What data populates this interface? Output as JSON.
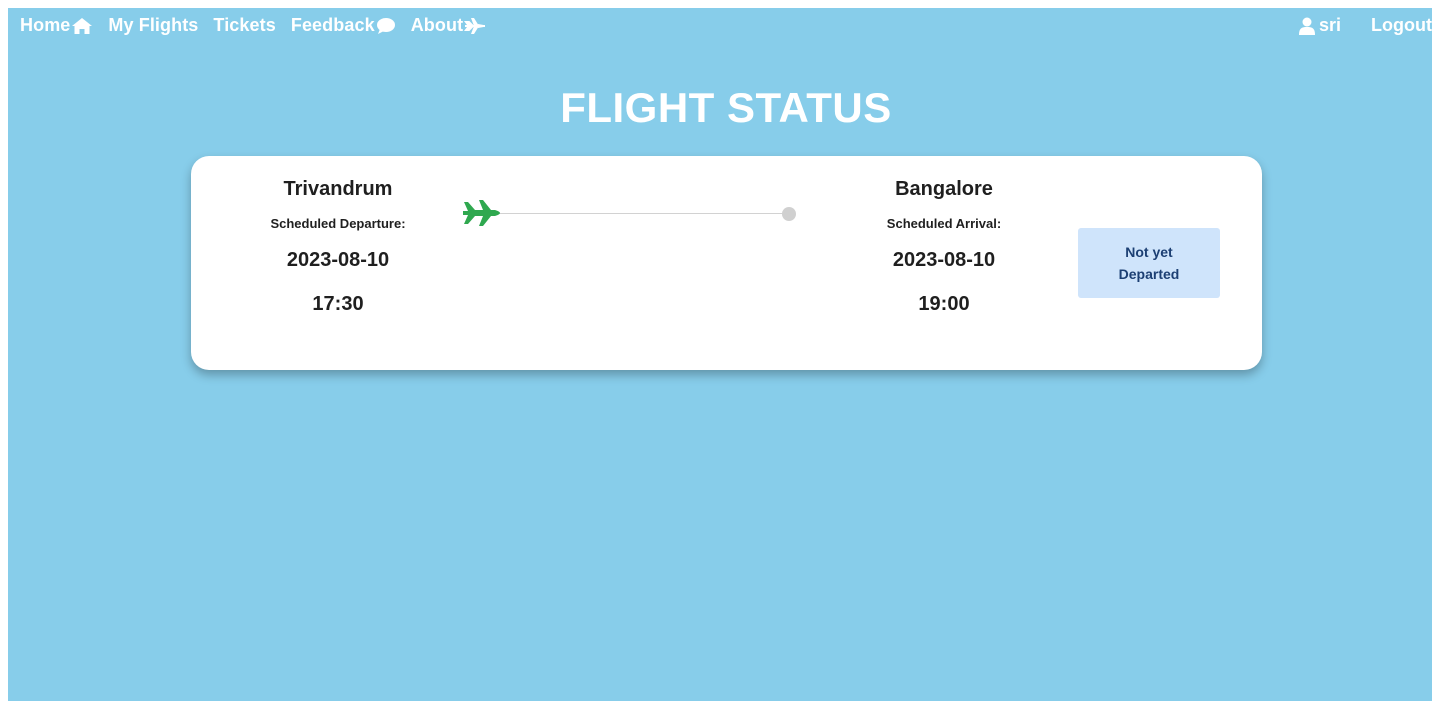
{
  "nav": {
    "home_label": "Home",
    "my_flights_label": "My Flights",
    "tickets_label": "Tickets",
    "feedback_label": "Feedback",
    "about_label": "About",
    "user_name": "sri",
    "logout_label": "Logout"
  },
  "page": {
    "title": "FLIGHT STATUS"
  },
  "flight": {
    "departure": {
      "city": "Trivandrum",
      "label": "Scheduled Departure:",
      "date": "2023-08-10",
      "time": "17:30"
    },
    "arrival": {
      "city": "Bangalore",
      "label": "Scheduled Arrival:",
      "date": "2023-08-10",
      "time": "19:00"
    },
    "status": "Not yet Departed",
    "progress": 0
  },
  "colors": {
    "background": "#87cdea",
    "plane": "#2fa84f",
    "status_bg": "#cfe4fb",
    "status_text": "#1c3f73"
  },
  "icons": {
    "home": "home-icon",
    "feedback": "chat-bubble-icon",
    "about": "airplane-icon",
    "user": "user-icon",
    "route": "jet-plane-icon"
  }
}
